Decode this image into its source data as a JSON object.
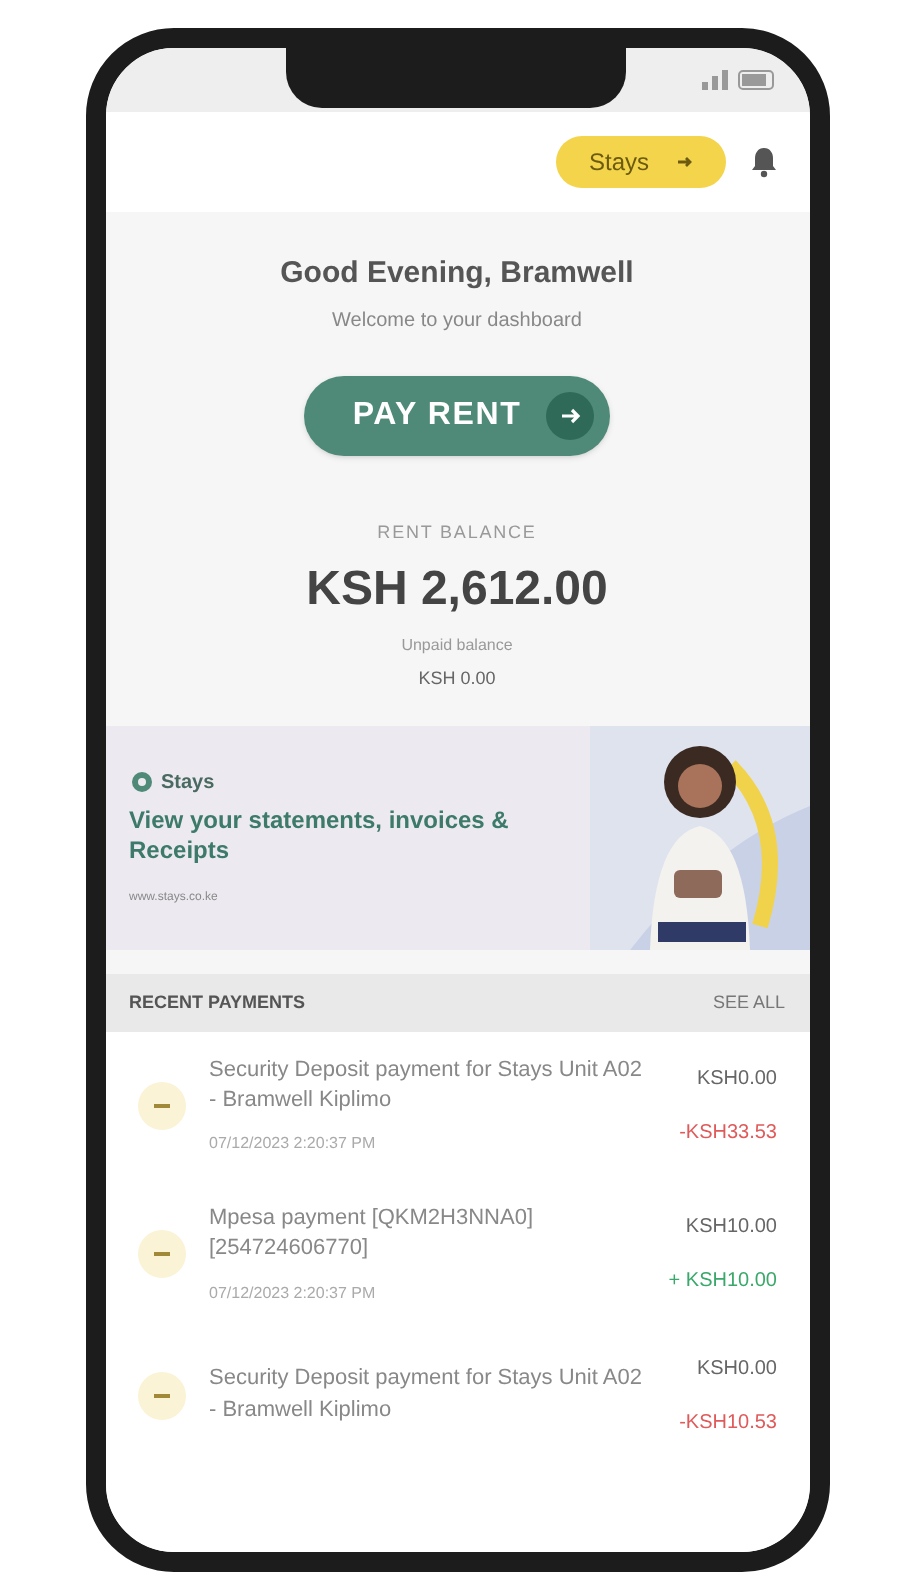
{
  "header": {
    "brand_pill": "Stays"
  },
  "greeting": {
    "title": "Good Evening, Bramwell",
    "subtitle": "Welcome to your dashboard"
  },
  "pay_button": "PAY RENT",
  "balance": {
    "label": "RENT BALANCE",
    "amount": "KSH 2,612.00",
    "secondary_label": "Unpaid balance",
    "secondary_amount": "KSH 0.00"
  },
  "banner": {
    "logo": "Stays",
    "headline": "View your statements, invoices & Receipts",
    "footnote": "www.stays.co.ke"
  },
  "recent_payments": {
    "title": "RECENT PAYMENTS",
    "link": "SEE ALL",
    "items": [
      {
        "description": "Security Deposit payment for Stays Unit A02 - Bramwell Kiplimo",
        "date": "07/12/2023 2:20:37 PM",
        "amount": "KSH0.00",
        "change": "-KSH33.53",
        "color": "#e05a5a"
      },
      {
        "description": "Mpesa payment [QKM2H3NNA0] [254724606770]",
        "date": "07/12/2023 2:20:37 PM",
        "amount": "KSH10.00",
        "change": "+ KSH10.00",
        "color": "#3aa86b"
      },
      {
        "description": "Security Deposit payment for Stays Unit A02 - Bramwell Kiplimo",
        "amount": "KSH0.00",
        "change": "-KSH10.53",
        "color": "#e05a5a"
      }
    ]
  }
}
